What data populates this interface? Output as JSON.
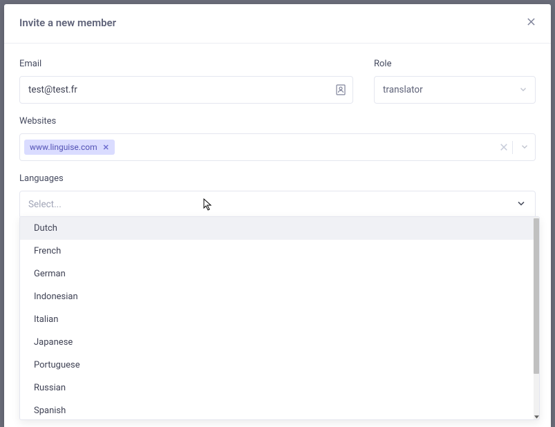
{
  "modal": {
    "title": "Invite a new member"
  },
  "fields": {
    "email": {
      "label": "Email",
      "value": "test@test.fr"
    },
    "role": {
      "label": "Role",
      "value": "translator"
    },
    "websites": {
      "label": "Websites",
      "tags": [
        {
          "label": "www.linguise.com"
        }
      ]
    },
    "languages": {
      "label": "Languages",
      "placeholder": "Select...",
      "options": [
        {
          "label": "Dutch",
          "highlighted": true
        },
        {
          "label": "French"
        },
        {
          "label": "German"
        },
        {
          "label": "Indonesian"
        },
        {
          "label": "Italian"
        },
        {
          "label": "Japanese"
        },
        {
          "label": "Portuguese"
        },
        {
          "label": "Russian"
        },
        {
          "label": "Spanish"
        }
      ]
    }
  }
}
